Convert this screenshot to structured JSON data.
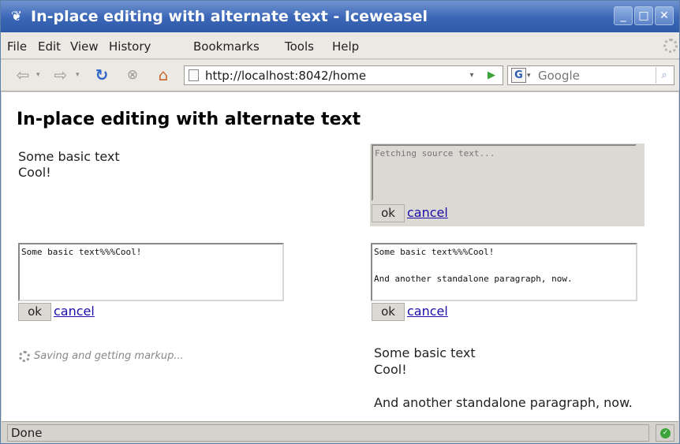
{
  "window": {
    "title": "In-place editing with alternate text - Iceweasel"
  },
  "menu": [
    "File",
    "Edit",
    "View",
    "History",
    "Bookmarks",
    "Tools",
    "Help"
  ],
  "nav": {
    "url": "http://localhost:8042/home",
    "search_placeholder": "Google"
  },
  "page": {
    "title": "In-place editing with alternate text",
    "left_text_line1": "Some basic text",
    "left_text_line2": "Cool!",
    "fetch_placeholder": "Fetching source text...",
    "editor_left_value": "Some basic text%%%Cool!",
    "editor_right_value": "Some basic text%%%Cool!\n\nAnd another standalone paragraph, now.",
    "ok_label": "ok",
    "cancel_label": "cancel",
    "saving_text": "Saving and getting markup...",
    "result_line1": "Some basic text",
    "result_line2": "Cool!",
    "result_para2": "And another standalone paragraph, now."
  },
  "status": {
    "text": "Done"
  }
}
